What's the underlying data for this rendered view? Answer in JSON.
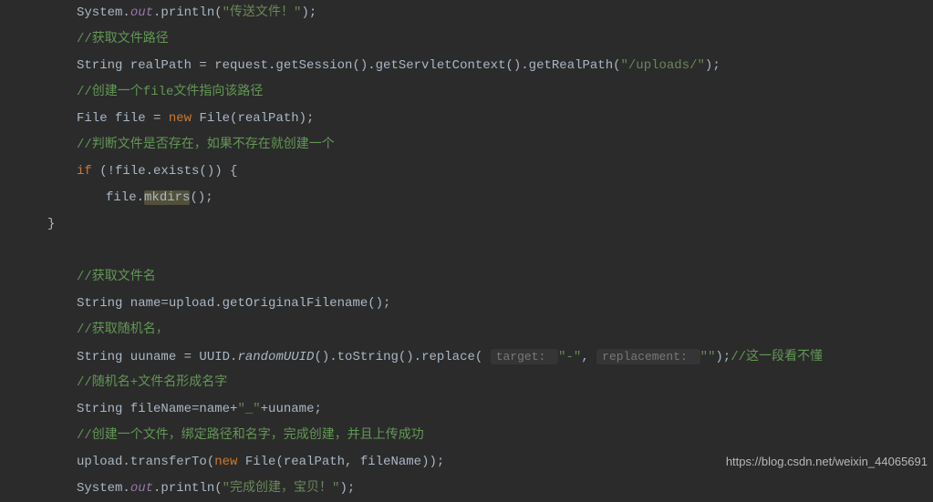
{
  "lines": {
    "l1": {
      "p1": "System.",
      "p2": "out",
      "p3": ".println(",
      "s1": "\"传送文件！\"",
      "p4": ");"
    },
    "l2": {
      "c": "//获取文件路径"
    },
    "l3": {
      "p1": "String realPath = request.getSession().getServletContext().getRealPath(",
      "s1": "\"/uploads/\"",
      "p2": ");"
    },
    "l4": {
      "c": "//创建一个file文件指向该路径"
    },
    "l5": {
      "p1": "File file = ",
      "k1": "new ",
      "p2": "File(realPath);"
    },
    "l6": {
      "c": "//判断文件是否存在，如果不存在就创建一个"
    },
    "l7": {
      "k1": "if ",
      "p1": "(!file.exists()) {"
    },
    "l8": {
      "p1": "file.",
      "m1": "mkdirs",
      "p2": "();"
    },
    "l9": {
      "p1": "}"
    },
    "l10": {
      "c": "//获取文件名"
    },
    "l11": {
      "p1": "String name=upload.getOriginalFilename();"
    },
    "l12": {
      "c": "//获取随机名，"
    },
    "l13": {
      "p1": "String uuname = UUID.",
      "m1": "randomUUID",
      "p2": "().toString().replace( ",
      "h1": "target: ",
      "s1": "\"-\"",
      "p3": ", ",
      "h2": "replacement: ",
      "s2": "\"\"",
      "p4": ");",
      "c1": "//这一段看不懂"
    },
    "l14": {
      "c": "//随机名+文件名形成名字"
    },
    "l15": {
      "p1": "String fileName=name+",
      "s1": "\"_\"",
      "p2": "+uuname;"
    },
    "l16": {
      "c": "//创建一个文件，绑定路径和名字，完成创建，并且上传成功"
    },
    "l17": {
      "p1": "upload.transferTo(",
      "k1": "new ",
      "p2": "File(realPath, fileName));"
    },
    "l18": {
      "p1": "System.",
      "p2": "out",
      "p3": ".println(",
      "s1": "\"完成创建，宝贝！\"",
      "p4": ");"
    }
  },
  "watermark": "https://blog.csdn.net/weixin_44065691"
}
